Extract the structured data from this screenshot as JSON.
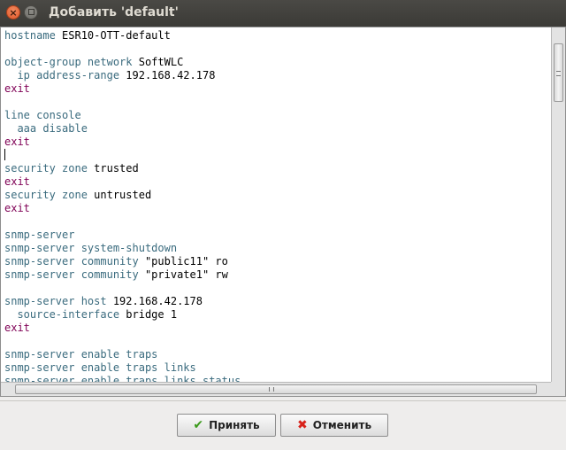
{
  "window": {
    "title": "Добавить 'default'",
    "close_glyph": "×"
  },
  "editor": {
    "lines": [
      [
        [
          "t",
          "hostname"
        ],
        [
          "v",
          " ESR10-OTT-default"
        ]
      ],
      [],
      [
        [
          "t",
          "object-group network"
        ],
        [
          "v",
          " SoftWLC"
        ]
      ],
      [
        [
          "t",
          "  ip address-range"
        ],
        [
          "v",
          " 192.168.42.178"
        ]
      ],
      [
        [
          "e",
          "exit"
        ]
      ],
      [],
      [
        [
          "t",
          "line console"
        ]
      ],
      [
        [
          "t",
          "  aaa disable"
        ]
      ],
      [
        [
          "e",
          "exit"
        ]
      ],
      [
        [
          "c",
          ""
        ]
      ],
      [
        [
          "t",
          "security zone"
        ],
        [
          "v",
          " trusted"
        ]
      ],
      [
        [
          "e",
          "exit"
        ]
      ],
      [
        [
          "t",
          "security zone"
        ],
        [
          "v",
          " untrusted"
        ]
      ],
      [
        [
          "e",
          "exit"
        ]
      ],
      [],
      [
        [
          "t",
          "snmp-server"
        ]
      ],
      [
        [
          "t",
          "snmp-server system-shutdown"
        ]
      ],
      [
        [
          "t",
          "snmp-server community"
        ],
        [
          "v",
          " \"public11\" ro"
        ]
      ],
      [
        [
          "t",
          "snmp-server community"
        ],
        [
          "v",
          " \"private1\" rw"
        ]
      ],
      [],
      [
        [
          "t",
          "snmp-server host"
        ],
        [
          "v",
          " 192.168.42.178"
        ]
      ],
      [
        [
          "t",
          "  source-interface"
        ],
        [
          "v",
          " bridge 1"
        ]
      ],
      [
        [
          "e",
          "exit"
        ]
      ],
      [],
      [
        [
          "t",
          "snmp-server enable traps"
        ]
      ],
      [
        [
          "t",
          "snmp-server enable traps links"
        ]
      ],
      [
        [
          "t",
          "snmp-server enable traps links status"
        ]
      ]
    ]
  },
  "buttons": {
    "ok_label": "Принять",
    "cancel_label": "Отменить"
  },
  "colors": {
    "keyword": "#3a6b7e",
    "exit": "#7f0055",
    "value": "#000000"
  },
  "icons": {
    "ok": "check-icon",
    "cancel": "x-icon"
  }
}
